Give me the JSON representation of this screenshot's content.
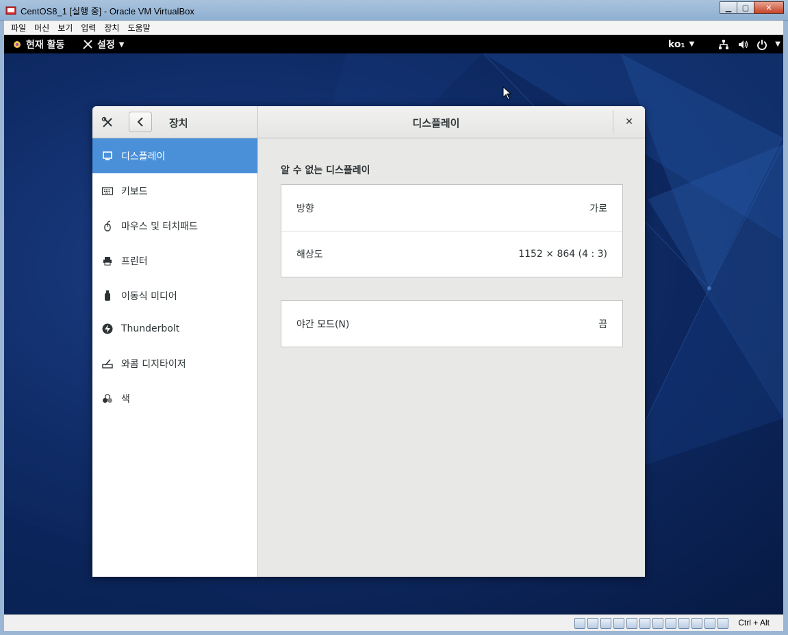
{
  "host": {
    "title": "CentOS8_1 [실행 중] - Oracle VM VirtualBox",
    "menu": [
      "파일",
      "머신",
      "보기",
      "입력",
      "장치",
      "도움말"
    ],
    "host_key": "Ctrl + Alt"
  },
  "topbar": {
    "activities": "현재 활동",
    "app_menu": "설정",
    "input_source": "ko₁"
  },
  "settings": {
    "sidebar_title": "장치",
    "panel_title": "디스플레이",
    "sidebar_items": [
      {
        "label": "디스플레이",
        "icon": "display-icon",
        "active": true
      },
      {
        "label": "키보드",
        "icon": "keyboard-icon",
        "active": false
      },
      {
        "label": "마우스 및 터치패드",
        "icon": "mouse-icon",
        "active": false
      },
      {
        "label": "프린터",
        "icon": "printer-icon",
        "active": false
      },
      {
        "label": "이동식 미디어",
        "icon": "usb-drive-icon",
        "active": false
      },
      {
        "label": "Thunderbolt",
        "icon": "thunderbolt-icon",
        "active": false
      },
      {
        "label": "와콤 디지타이저",
        "icon": "tablet-icon",
        "active": false
      },
      {
        "label": "색",
        "icon": "color-icon",
        "active": false
      }
    ],
    "display": {
      "section_title": "알 수 없는 디스플레이",
      "orientation_label": "방향",
      "orientation_value": "가로",
      "resolution_label": "해상도",
      "resolution_value": "1152 × 864 (4 : 3)",
      "night_mode_label": "야간 모드(N)",
      "night_mode_value": "끔"
    }
  },
  "colors": {
    "accent": "#4a90d9",
    "topbar": "#000000",
    "desktop": "#0f2b66"
  }
}
